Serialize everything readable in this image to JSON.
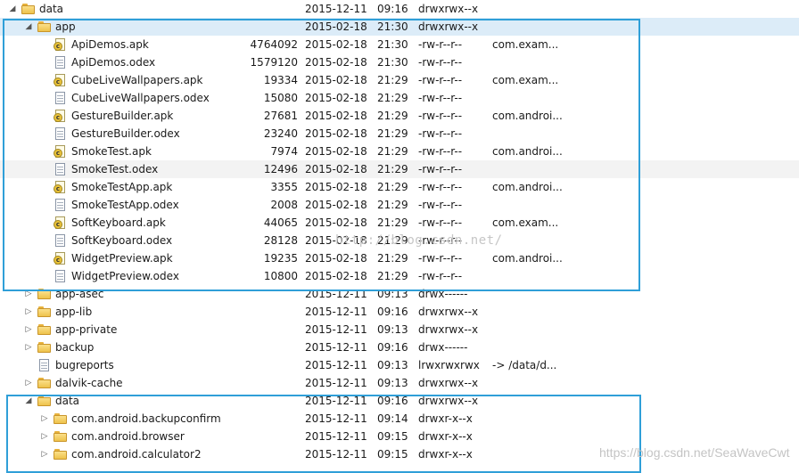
{
  "rows": [
    {
      "depth": 0,
      "icon": "folder-open",
      "twisty": "expanded",
      "name": "data",
      "size": "",
      "date": "2015-12-11",
      "time": "09:16",
      "perm": "drwxrwx--x",
      "info": ""
    },
    {
      "depth": 1,
      "icon": "folder-open",
      "twisty": "expanded",
      "name": "app",
      "size": "",
      "date": "2015-02-18",
      "time": "21:30",
      "perm": "drwxrwx--x",
      "info": "",
      "state": "selected"
    },
    {
      "depth": 2,
      "icon": "apk",
      "twisty": "",
      "name": "ApiDemos.apk",
      "size": "4764092",
      "date": "2015-02-18",
      "time": "21:30",
      "perm": "-rw-r--r--",
      "info": "com.exam..."
    },
    {
      "depth": 2,
      "icon": "file",
      "twisty": "",
      "name": "ApiDemos.odex",
      "size": "1579120",
      "date": "2015-02-18",
      "time": "21:30",
      "perm": "-rw-r--r--",
      "info": ""
    },
    {
      "depth": 2,
      "icon": "apk",
      "twisty": "",
      "name": "CubeLiveWallpapers.apk",
      "size": "19334",
      "date": "2015-02-18",
      "time": "21:29",
      "perm": "-rw-r--r--",
      "info": "com.exam..."
    },
    {
      "depth": 2,
      "icon": "file",
      "twisty": "",
      "name": "CubeLiveWallpapers.odex",
      "size": "15080",
      "date": "2015-02-18",
      "time": "21:29",
      "perm": "-rw-r--r--",
      "info": ""
    },
    {
      "depth": 2,
      "icon": "apk",
      "twisty": "",
      "name": "GestureBuilder.apk",
      "size": "27681",
      "date": "2015-02-18",
      "time": "21:29",
      "perm": "-rw-r--r--",
      "info": "com.androi..."
    },
    {
      "depth": 2,
      "icon": "file",
      "twisty": "",
      "name": "GestureBuilder.odex",
      "size": "23240",
      "date": "2015-02-18",
      "time": "21:29",
      "perm": "-rw-r--r--",
      "info": ""
    },
    {
      "depth": 2,
      "icon": "apk",
      "twisty": "",
      "name": "SmokeTest.apk",
      "size": "7974",
      "date": "2015-02-18",
      "time": "21:29",
      "perm": "-rw-r--r--",
      "info": "com.androi..."
    },
    {
      "depth": 2,
      "icon": "file",
      "twisty": "",
      "name": "SmokeTest.odex",
      "size": "12496",
      "date": "2015-02-18",
      "time": "21:29",
      "perm": "-rw-r--r--",
      "info": "",
      "state": "hover"
    },
    {
      "depth": 2,
      "icon": "apk",
      "twisty": "",
      "name": "SmokeTestApp.apk",
      "size": "3355",
      "date": "2015-02-18",
      "time": "21:29",
      "perm": "-rw-r--r--",
      "info": "com.androi..."
    },
    {
      "depth": 2,
      "icon": "file",
      "twisty": "",
      "name": "SmokeTestApp.odex",
      "size": "2008",
      "date": "2015-02-18",
      "time": "21:29",
      "perm": "-rw-r--r--",
      "info": ""
    },
    {
      "depth": 2,
      "icon": "apk",
      "twisty": "",
      "name": "SoftKeyboard.apk",
      "size": "44065",
      "date": "2015-02-18",
      "time": "21:29",
      "perm": "-rw-r--r--",
      "info": "com.exam..."
    },
    {
      "depth": 2,
      "icon": "file",
      "twisty": "",
      "name": "SoftKeyboard.odex",
      "size": "28128",
      "date": "2015-02-18",
      "time": "21:29",
      "perm": "-rw-r--r--",
      "info": ""
    },
    {
      "depth": 2,
      "icon": "apk",
      "twisty": "",
      "name": "WidgetPreview.apk",
      "size": "19235",
      "date": "2015-02-18",
      "time": "21:29",
      "perm": "-rw-r--r--",
      "info": "com.androi..."
    },
    {
      "depth": 2,
      "icon": "file",
      "twisty": "",
      "name": "WidgetPreview.odex",
      "size": "10800",
      "date": "2015-02-18",
      "time": "21:29",
      "perm": "-rw-r--r--",
      "info": ""
    },
    {
      "depth": 1,
      "icon": "folder",
      "twisty": "collapsed",
      "name": "app-asec",
      "size": "",
      "date": "2015-12-11",
      "time": "09:13",
      "perm": "drwx------",
      "info": ""
    },
    {
      "depth": 1,
      "icon": "folder",
      "twisty": "collapsed",
      "name": "app-lib",
      "size": "",
      "date": "2015-12-11",
      "time": "09:16",
      "perm": "drwxrwx--x",
      "info": ""
    },
    {
      "depth": 1,
      "icon": "folder",
      "twisty": "collapsed",
      "name": "app-private",
      "size": "",
      "date": "2015-12-11",
      "time": "09:13",
      "perm": "drwxrwx--x",
      "info": ""
    },
    {
      "depth": 1,
      "icon": "folder",
      "twisty": "collapsed",
      "name": "backup",
      "size": "",
      "date": "2015-12-11",
      "time": "09:16",
      "perm": "drwx------",
      "info": ""
    },
    {
      "depth": 1,
      "icon": "file",
      "twisty": "",
      "name": "bugreports",
      "size": "",
      "date": "2015-12-11",
      "time": "09:13",
      "perm": "lrwxrwxrwx",
      "info": "-> /data/d..."
    },
    {
      "depth": 1,
      "icon": "folder",
      "twisty": "collapsed",
      "name": "dalvik-cache",
      "size": "",
      "date": "2015-12-11",
      "time": "09:13",
      "perm": "drwxrwx--x",
      "info": ""
    },
    {
      "depth": 1,
      "icon": "folder-open",
      "twisty": "expanded",
      "name": "data",
      "size": "",
      "date": "2015-12-11",
      "time": "09:16",
      "perm": "drwxrwx--x",
      "info": ""
    },
    {
      "depth": 2,
      "icon": "folder",
      "twisty": "collapsed",
      "name": "com.android.backupconfirm",
      "size": "",
      "date": "2015-12-11",
      "time": "09:14",
      "perm": "drwxr-x--x",
      "info": ""
    },
    {
      "depth": 2,
      "icon": "folder",
      "twisty": "collapsed",
      "name": "com.android.browser",
      "size": "",
      "date": "2015-12-11",
      "time": "09:15",
      "perm": "drwxr-x--x",
      "info": ""
    },
    {
      "depth": 2,
      "icon": "folder",
      "twisty": "collapsed",
      "name": "com.android.calculator2",
      "size": "",
      "date": "2015-12-11",
      "time": "09:15",
      "perm": "drwxr-x--x",
      "info": ""
    }
  ],
  "watermark": "http://blog.csdn.net/",
  "credit": "https://blog.csdn.net/SeaWaveCwt",
  "colors": {
    "frame": "#2f9fd8",
    "selected": "#dcecf8",
    "folder": "#eec24b"
  }
}
